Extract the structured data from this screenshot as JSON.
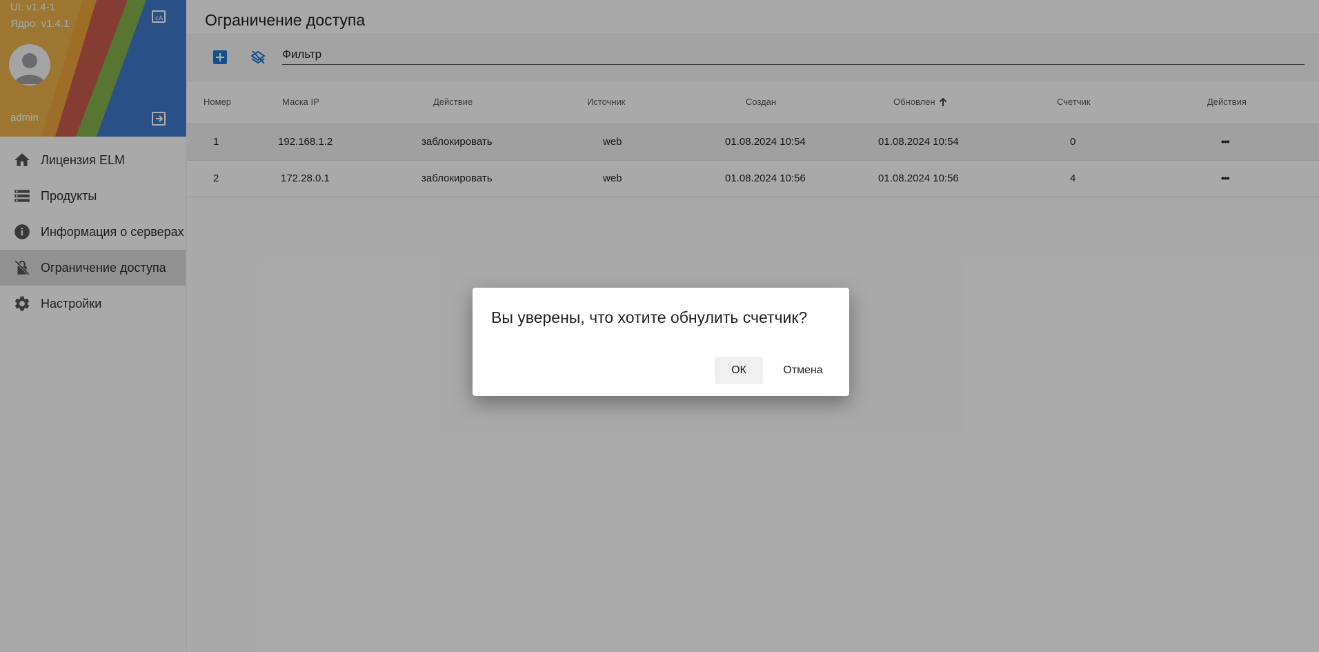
{
  "sidebar": {
    "version_ui": "UI: v1.4-1",
    "version_core": "Ядро: v1.4.1",
    "username": "admin",
    "items": [
      {
        "label": "Лицензия ELM",
        "icon": "home-icon"
      },
      {
        "label": "Продукты",
        "icon": "storage-icon"
      },
      {
        "label": "Информация о серверах",
        "icon": "info-icon"
      },
      {
        "label": "Ограничение доступа",
        "icon": "no-encryption-icon",
        "active": true
      },
      {
        "label": "Настройки",
        "icon": "settings-icon"
      }
    ]
  },
  "page": {
    "title": "Ограничение доступа"
  },
  "toolbar": {
    "filter_placeholder": "Фильтр"
  },
  "table": {
    "headers": [
      "Номер",
      "Маска IP",
      "Действие",
      "Источник",
      "Создан",
      "Обновлен",
      "Счетчик",
      "Действия"
    ],
    "sort_column": "Обновлен",
    "sort_direction": "ascending",
    "rows": [
      {
        "num": "1",
        "mask": "192.168.1.2",
        "action": "заблокировать",
        "source": "web",
        "created": "01.08.2024 10:54",
        "updated": "01.08.2024 10:54",
        "counter": "0",
        "menu": "•••"
      },
      {
        "num": "2",
        "mask": "172.28.0.1",
        "action": "заблокировать",
        "source": "web",
        "created": "01.08.2024 10:56",
        "updated": "01.08.2024 10:56",
        "counter": "4",
        "menu": "•••"
      }
    ]
  },
  "dialog": {
    "title": "Вы уверены, что хотите обнулить счетчик?",
    "ok_label": "ОК",
    "cancel_label": "Отмена"
  },
  "colors": {
    "accent": "#1976d2",
    "active_nav": "#d6d6d6",
    "overlay": "rgba(0,0,0,0.32)"
  }
}
